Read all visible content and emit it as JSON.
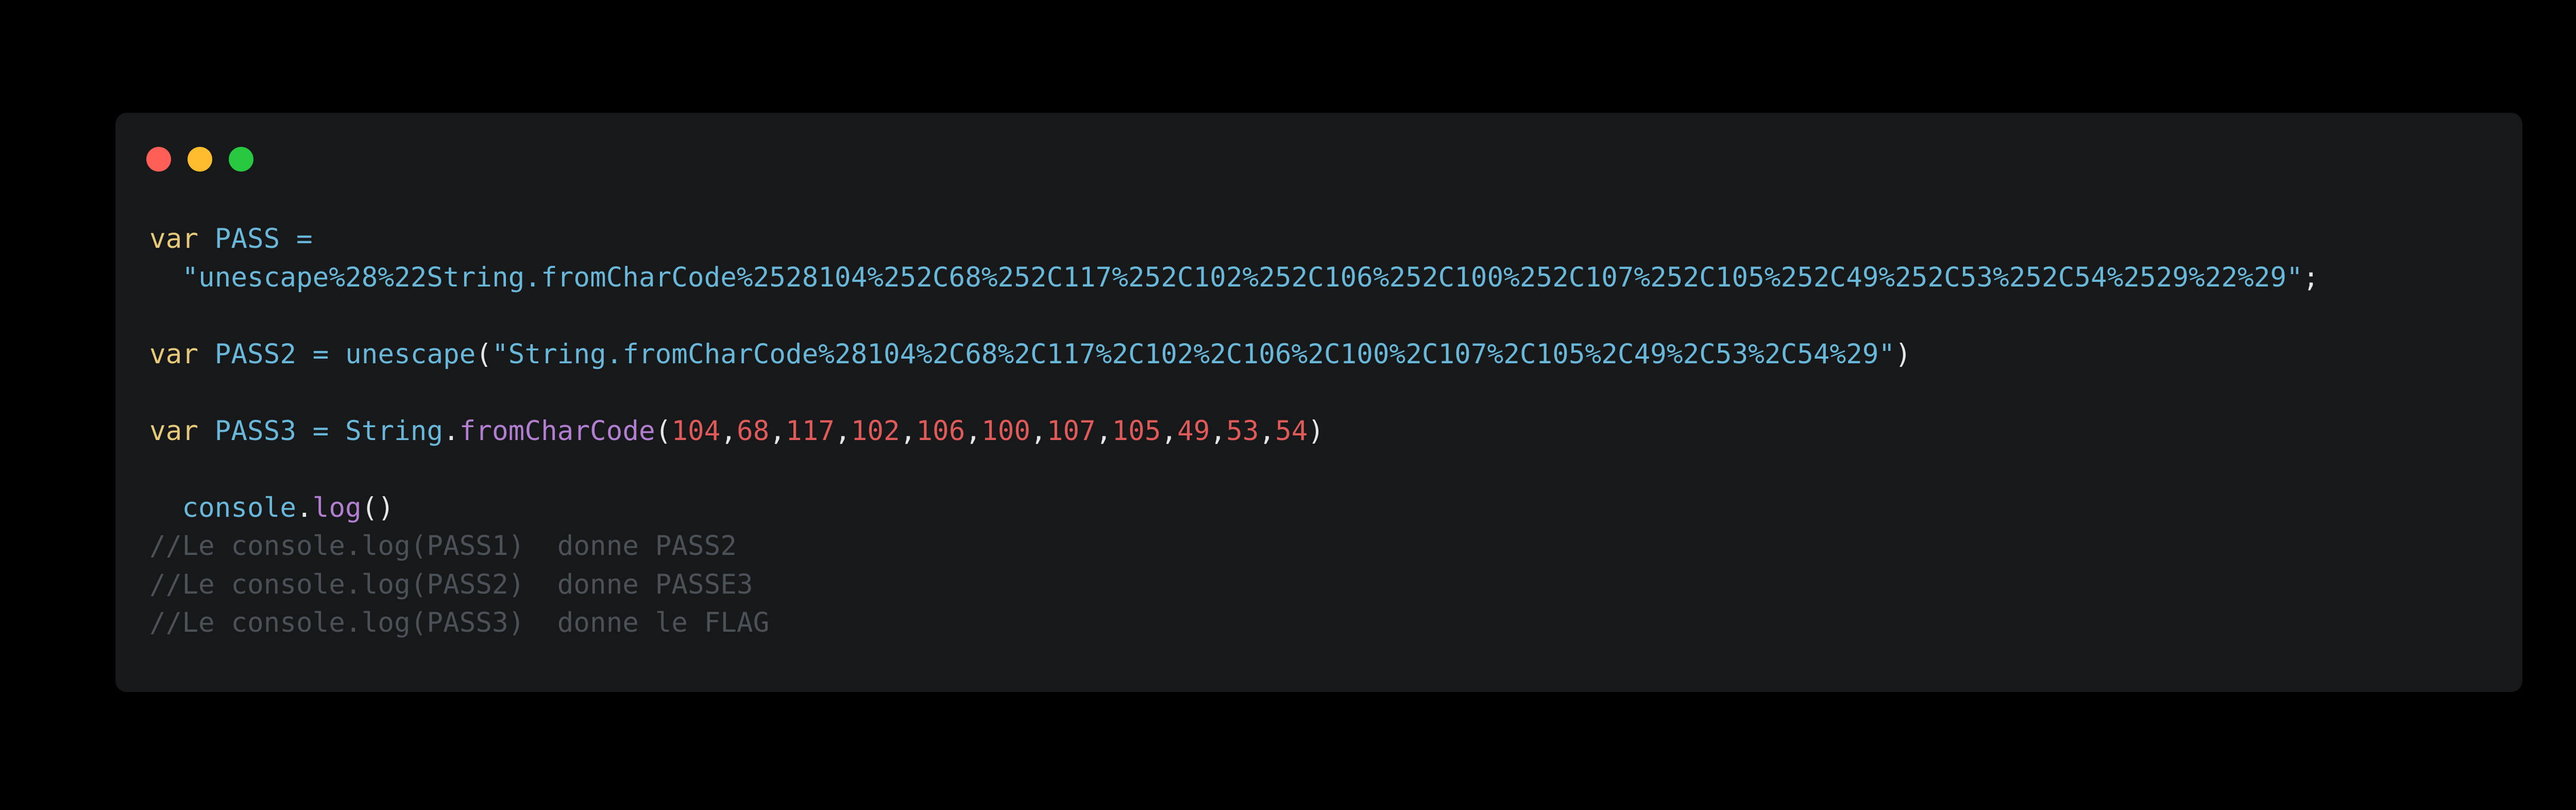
{
  "colors": {
    "background": "#000000",
    "window": "#17181a",
    "close": "#ff5f57",
    "minimize": "#febc2e",
    "maximize": "#28c840",
    "keyword": "#e6c97a",
    "identifier": "#69b7d9",
    "string": "#69b7d9",
    "method": "#b27ed0",
    "number": "#e05a5a",
    "punctuation": "#e6e6e6",
    "comment": "#4b5157"
  },
  "window_controls": [
    "close-icon",
    "minimize-icon",
    "maximize-icon"
  ],
  "code": {
    "l1_kw": "var",
    "l1_sp": " ",
    "l1_name": "PASS",
    "l1_eq": " =",
    "l2_indent": "  ",
    "l2_str": "\"unescape%28%22String.fromCharCode%2528104%252C68%252C117%252C102%252C106%252C100%252C107%252C105%252C49%252C53%252C54%2529%22%29\"",
    "l2_semi": ";",
    "l4_kw": "var",
    "l4_sp": " ",
    "l4_name": "PASS2",
    "l4_eq": " = ",
    "l4_fn": "unescape",
    "l4_open": "(",
    "l4_str": "\"String.fromCharCode%28104%2C68%2C117%2C102%2C106%2C100%2C107%2C105%2C49%2C53%2C54%29\"",
    "l4_close": ")",
    "l6_kw": "var",
    "l6_sp": " ",
    "l6_name": "PASS3",
    "l6_eq": " = ",
    "l6_obj": "String",
    "l6_dot": ".",
    "l6_method": "fromCharCode",
    "l6_open": "(",
    "l6_close": ")",
    "l6_comma": ",",
    "l6_args": [
      "104",
      "68",
      "117",
      "102",
      "106",
      "100",
      "107",
      "105",
      "49",
      "53",
      "54"
    ],
    "l8_indent": "  ",
    "l8_obj": "console",
    "l8_dot": ".",
    "l8_method": "log",
    "l8_parens": "()",
    "comment1": "//Le console.log(PASS1)  donne PASS2",
    "comment2": "//Le console.log(PASS2)  donne PASSE3",
    "comment3": "//Le console.log(PASS3)  donne le FLAG"
  }
}
